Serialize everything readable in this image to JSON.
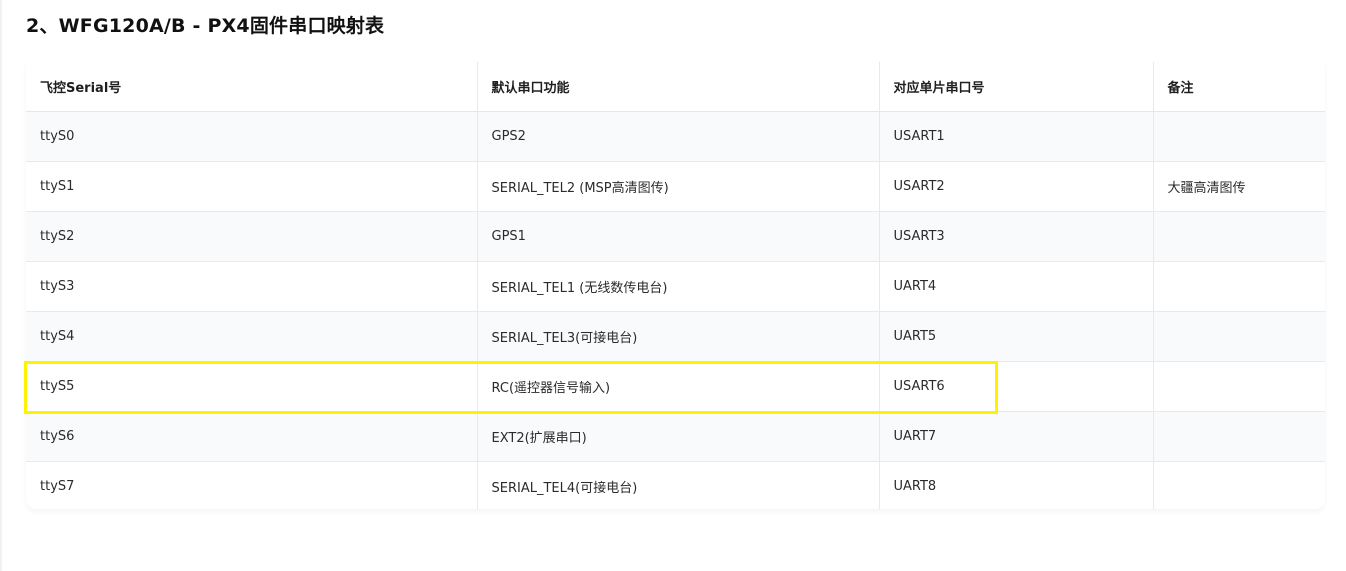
{
  "page": {
    "title": "2、WFG120A/B - PX4固件串口映射表"
  },
  "table": {
    "headers": [
      "飞控Serial号",
      "默认串口功能",
      "对应单片串口号",
      "备注"
    ],
    "rows": [
      [
        "ttyS0",
        "GPS2",
        "USART1",
        ""
      ],
      [
        "ttyS1",
        "SERIAL_TEL2 (MSP高清图传)",
        "USART2",
        "大疆高清图传"
      ],
      [
        "ttyS2",
        "GPS1",
        "USART3",
        ""
      ],
      [
        "ttyS3",
        "SERIAL_TEL1 (无线数传电台)",
        "UART4",
        ""
      ],
      [
        "ttyS4",
        "SERIAL_TEL3(可接电台)",
        "UART5",
        ""
      ],
      [
        "ttyS5",
        "RC(遥控器信号输入)",
        "USART6",
        ""
      ],
      [
        "ttyS6",
        "EXT2(扩展串口)",
        "UART7",
        ""
      ],
      [
        "ttyS7",
        "SERIAL_TEL4(可接电台)",
        "UART8",
        ""
      ]
    ],
    "highlighted_row": 5
  },
  "colors": {
    "highlight": "#fff200",
    "odd_row_bg": "#f9fafc",
    "grid_line": "#e8e9ec"
  }
}
